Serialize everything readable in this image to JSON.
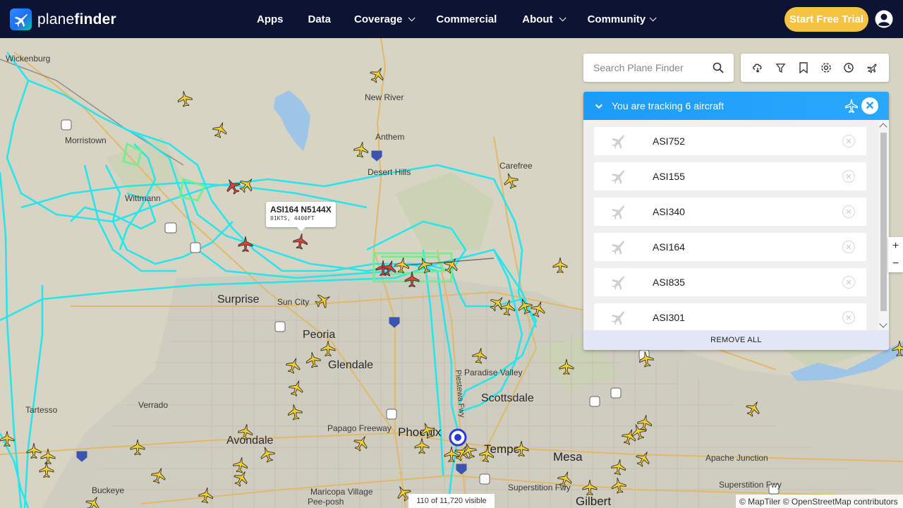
{
  "brand": {
    "name_light": "plane",
    "name_bold": "finder"
  },
  "nav": {
    "items": [
      {
        "label": "Apps",
        "has_menu": false
      },
      {
        "label": "Data",
        "has_menu": false
      },
      {
        "label": "Coverage",
        "has_menu": true
      },
      {
        "label": "Commercial",
        "has_menu": false
      },
      {
        "label": "About",
        "has_menu": true
      },
      {
        "label": "Community",
        "has_menu": true
      }
    ],
    "trial_label": "Start Free Trial"
  },
  "search": {
    "placeholder": "Search Plane Finder"
  },
  "toolbar": {
    "icons": [
      "weather-icon",
      "filter-icon",
      "bookmark-icon",
      "settings-icon",
      "history-icon",
      "ar-plane-icon"
    ]
  },
  "tracking": {
    "title": "You are tracking 6 aircraft",
    "aircraft": [
      "ASI752",
      "ASI155",
      "ASI340",
      "ASI164",
      "ASI835",
      "ASI301"
    ],
    "remove_all_label": "REMOVE ALL"
  },
  "callout": {
    "title": "ASI164 N5144X",
    "detail": "81KTS, 4400FT"
  },
  "map_labels": {
    "wickenburg": "Wickenburg",
    "new_river": "New River",
    "morristown": "Morristown",
    "anthem": "Anthem",
    "desert_hills": "Desert Hills",
    "carefree": "Carefree",
    "wittmann": "Wittmann",
    "surprise": "Surprise",
    "sun_city": "Sun City",
    "peoria": "Peoria",
    "glendale": "Glendale",
    "paradise_valley": "Paradise Valley",
    "scottsdale": "Scottsdale",
    "tartesso": "Tartesso",
    "verrado": "Verrado",
    "papago_freeway": "Papago Freeway",
    "phoenix": "Phoenix",
    "tempe": "Tempe",
    "mesa": "Mesa",
    "apache_junction": "Apache Junction",
    "avondale": "Avondale",
    "buckeye": "Buckeye",
    "maricopa_village": "Maricopa Village",
    "pee_posh": "Pee-posh",
    "superstition_fwy": "Superstition Fwy",
    "superstition_fwy2": "Superstition Fwy",
    "gilbert": "Gilbert",
    "piestewa_fwy": "Piestewa Fwy"
  },
  "route_shields": [
    "60",
    "17",
    "60",
    "60",
    "17",
    "101",
    "87",
    "87",
    "60",
    "10",
    "60",
    "60",
    "60",
    "51"
  ],
  "status": {
    "visible": "110 of 11,720 visible",
    "attribution": "© MapTiler © OpenStreetMap contributors"
  },
  "zoom": {
    "in": "+",
    "out": "−"
  },
  "colors": {
    "nav_bg": "#0d1433",
    "accent": "#1b9cf7",
    "trial": "#f5c242",
    "track": "#1ee8f0",
    "plane": "#f5d02a",
    "tracked_plane": "#d6453a"
  }
}
